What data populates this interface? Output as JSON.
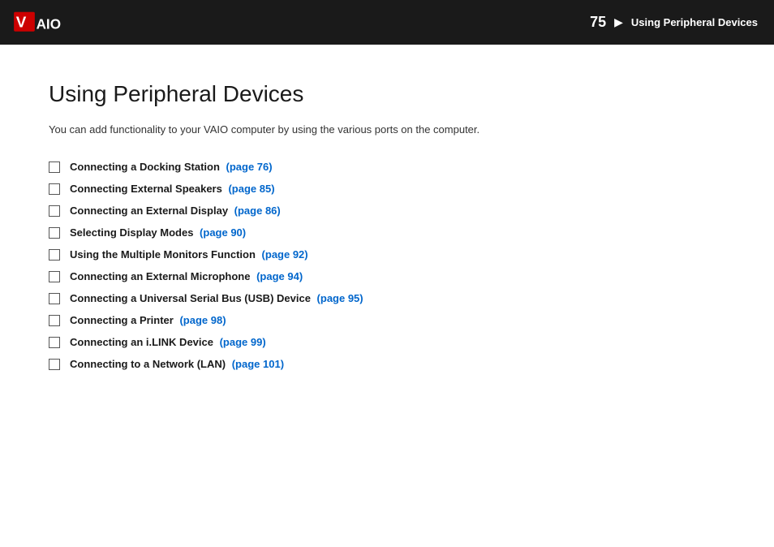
{
  "header": {
    "page_number": "75",
    "arrow": "▶",
    "section_title": "Using Peripheral Devices",
    "logo_alt": "VAIO"
  },
  "main": {
    "heading": "Using Peripheral Devices",
    "description": "You can add functionality to your VAIO computer by using the various ports on the computer.",
    "toc_items": [
      {
        "text": "Connecting a Docking Station",
        "link_text": "(page 76)"
      },
      {
        "text": "Connecting External Speakers",
        "link_text": "(page 85)"
      },
      {
        "text": "Connecting an External Display",
        "link_text": "(page 86)"
      },
      {
        "text": "Selecting Display Modes",
        "link_text": "(page 90)"
      },
      {
        "text": "Using the Multiple Monitors Function",
        "link_text": "(page 92)"
      },
      {
        "text": "Connecting an External Microphone",
        "link_text": "(page 94)"
      },
      {
        "text": "Connecting a Universal Serial Bus (USB) Device",
        "link_text": "(page 95)"
      },
      {
        "text": "Connecting a Printer",
        "link_text": "(page 98)"
      },
      {
        "text": "Connecting an i.LINK Device",
        "link_text": "(page 99)"
      },
      {
        "text": "Connecting to a Network (LAN)",
        "link_text": "(page 101)"
      }
    ]
  }
}
